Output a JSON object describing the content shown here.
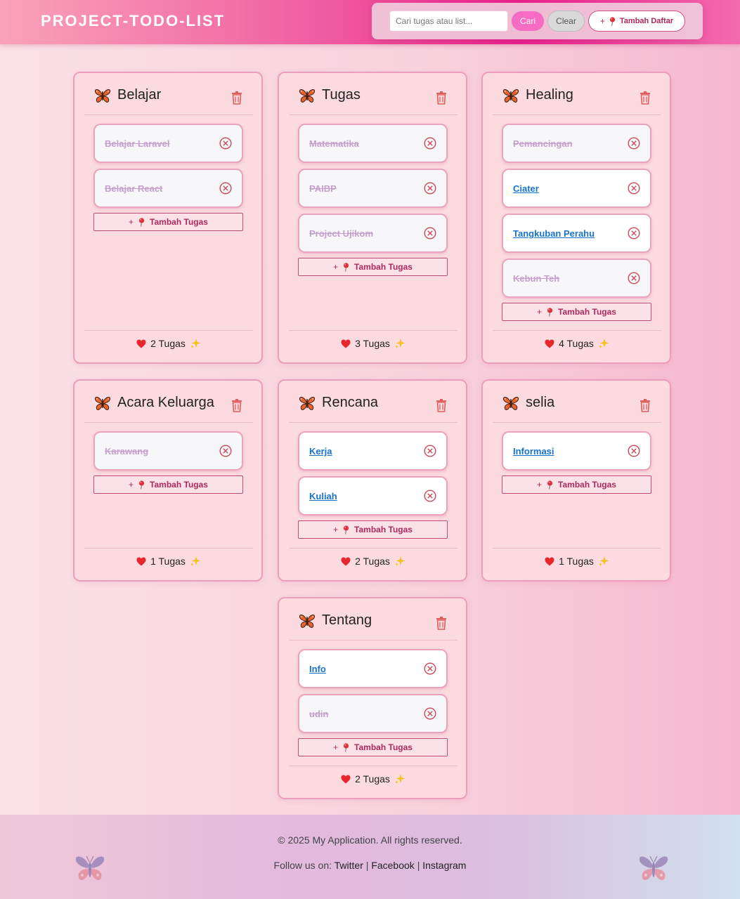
{
  "header": {
    "title": "PROJECT-TODO-LIST",
    "search_placeholder": "Cari tugas atau list...",
    "search_value": "",
    "search_button": "Cari",
    "clear_button": "Clear",
    "add_list_button": "Tambah Daftar"
  },
  "lists": [
    {
      "title": "Belajar",
      "tasks": [
        {
          "text": "Belajar Laravel",
          "done": true
        },
        {
          "text": "Belajar React",
          "done": true
        }
      ],
      "add_label": "Tambah Tugas",
      "count_label": "2 Tugas"
    },
    {
      "title": "Tugas",
      "tasks": [
        {
          "text": "Matematika",
          "done": true
        },
        {
          "text": "PAIBP",
          "done": true
        },
        {
          "text": "Project Ujikom",
          "done": true
        }
      ],
      "add_label": "Tambah Tugas",
      "count_label": "3 Tugas"
    },
    {
      "title": "Healing",
      "tasks": [
        {
          "text": "Pemancingan",
          "done": true
        },
        {
          "text": "Ciater",
          "done": false
        },
        {
          "text": "Tangkuban Perahu",
          "done": false
        },
        {
          "text": "Kebun Teh",
          "done": true
        }
      ],
      "add_label": "Tambah Tugas",
      "count_label": "4 Tugas"
    },
    {
      "title": "Acara Keluarga",
      "tasks": [
        {
          "text": "Karawang",
          "done": true
        }
      ],
      "add_label": "Tambah Tugas",
      "count_label": "1 Tugas"
    },
    {
      "title": "Rencana",
      "tasks": [
        {
          "text": "Kerja",
          "done": false
        },
        {
          "text": "Kuliah",
          "done": false
        }
      ],
      "add_label": "Tambah Tugas",
      "count_label": "2 Tugas"
    },
    {
      "title": "selia",
      "tasks": [
        {
          "text": "Informasi",
          "done": false
        }
      ],
      "add_label": "Tambah Tugas",
      "count_label": "1 Tugas"
    },
    {
      "title": "Tentang",
      "tasks": [
        {
          "text": "Info",
          "done": false
        },
        {
          "text": "udin",
          "done": true
        }
      ],
      "add_label": "Tambah Tugas",
      "count_label": "2 Tugas"
    }
  ],
  "footer": {
    "copyright": "© 2025 My Application. All rights reserved.",
    "follow_label": "Follow us on:",
    "links": [
      "Twitter",
      "Facebook",
      "Instagram"
    ]
  },
  "icons": {
    "list": "butterfly-icon",
    "delete_list": "trash-icon",
    "delete_task": "close-circle-icon",
    "add": "pushpin-icon",
    "count_left": "heart-icon",
    "count_right": "sparkles-icon",
    "footer_decoration": "butterfly-icon"
  },
  "colors": {
    "accent": "#ec1f8c",
    "link": "#1673cf",
    "done_text": "#c5a0cd",
    "card_border": "#ec9cbc"
  }
}
